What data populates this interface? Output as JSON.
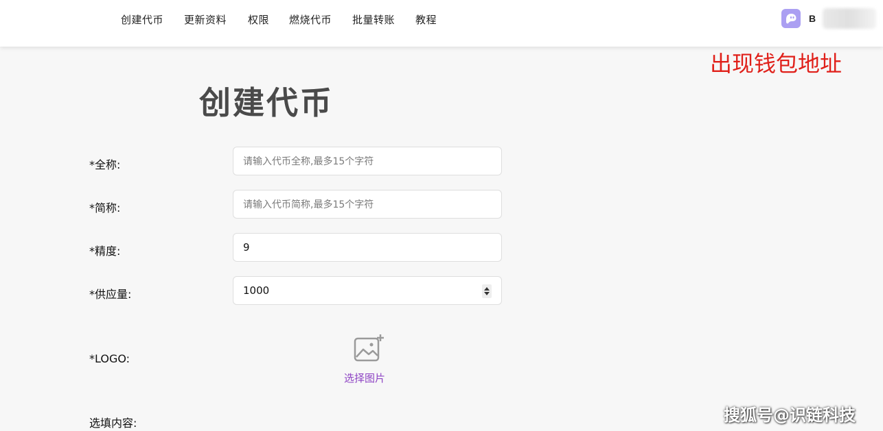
{
  "nav": {
    "items": [
      {
        "label": "创建代币"
      },
      {
        "label": "更新资料"
      },
      {
        "label": "权限"
      },
      {
        "label": "燃烧代币"
      },
      {
        "label": "批量转账"
      },
      {
        "label": "教程"
      }
    ],
    "wallet_address": "B",
    "wallet_icon": "phantom-ghost-icon"
  },
  "annotation": "出现钱包地址",
  "page_title": "创建代币",
  "form": {
    "full_name": {
      "label": "*全称:",
      "placeholder": "请输入代币全称,最多15个字符",
      "value": ""
    },
    "short_name": {
      "label": "*简称:",
      "placeholder": "请输入代币简称,最多15个字符",
      "value": ""
    },
    "decimals": {
      "label": "*精度:",
      "value": "9"
    },
    "supply": {
      "label": "*供应量:",
      "value": "1000"
    },
    "logo": {
      "label": "*LOGO:",
      "upload_label": "选择图片",
      "icon": "add-image-icon"
    },
    "optional": {
      "label": "选填内容:"
    }
  },
  "watermark": "搜狐号@识链科技",
  "colors": {
    "accent": "#8e44c4",
    "wallet_icon_bg": "#ab9ff2",
    "annotation": "#e0201a"
  }
}
